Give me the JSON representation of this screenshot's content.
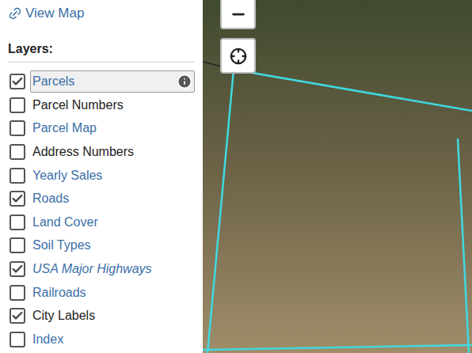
{
  "link": {
    "label": "View Map"
  },
  "layers_heading": "Layers:",
  "layers": [
    {
      "label": "Parcels",
      "checked": true,
      "selected": true,
      "link": true,
      "italic": false,
      "info": true
    },
    {
      "label": "Parcel Numbers",
      "checked": false,
      "selected": false,
      "link": false,
      "italic": false,
      "info": false
    },
    {
      "label": "Parcel Map",
      "checked": false,
      "selected": false,
      "link": true,
      "italic": false,
      "info": false
    },
    {
      "label": "Address Numbers",
      "checked": false,
      "selected": false,
      "link": false,
      "italic": false,
      "info": false
    },
    {
      "label": "Yearly Sales",
      "checked": false,
      "selected": false,
      "link": true,
      "italic": false,
      "info": false
    },
    {
      "label": "Roads",
      "checked": true,
      "selected": false,
      "link": true,
      "italic": false,
      "info": false
    },
    {
      "label": "Land Cover",
      "checked": false,
      "selected": false,
      "link": true,
      "italic": false,
      "info": false
    },
    {
      "label": "Soil Types",
      "checked": false,
      "selected": false,
      "link": true,
      "italic": false,
      "info": false
    },
    {
      "label": "USA Major Highways",
      "checked": true,
      "selected": false,
      "link": true,
      "italic": true,
      "info": false
    },
    {
      "label": "Railroads",
      "checked": false,
      "selected": false,
      "link": true,
      "italic": false,
      "info": false
    },
    {
      "label": "City Labels",
      "checked": true,
      "selected": false,
      "link": false,
      "italic": false,
      "info": false
    },
    {
      "label": "Index",
      "checked": false,
      "selected": false,
      "link": true,
      "italic": false,
      "info": false
    }
  ]
}
